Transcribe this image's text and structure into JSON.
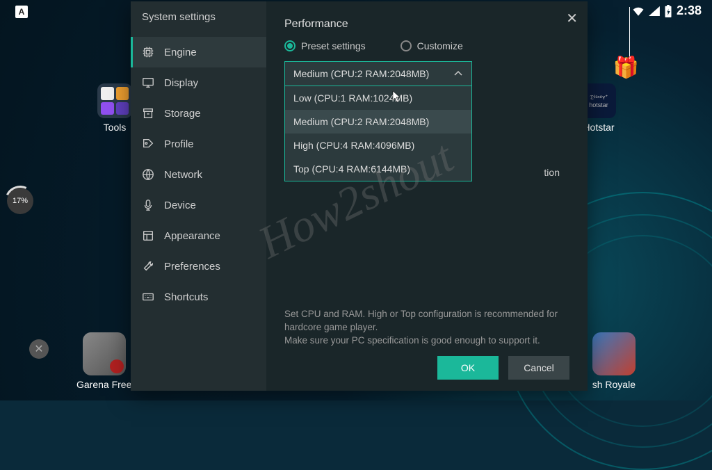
{
  "status_bar": {
    "time": "2:38"
  },
  "desktop": {
    "topleft_badge": "A",
    "tools_label": "Tools",
    "hotstar_label": "Hotstar",
    "hotstar_box_top": "𝔇ᴵˢⁿᵉʏ⁺",
    "hotstar_box_bottom": "hotstar",
    "pct": "17%",
    "game_left": "Garena Free",
    "game_right": "sh Royale"
  },
  "settings": {
    "title": "System settings",
    "sidebar": [
      {
        "label": "Engine",
        "icon": "cpu"
      },
      {
        "label": "Display",
        "icon": "monitor"
      },
      {
        "label": "Storage",
        "icon": "archive"
      },
      {
        "label": "Profile",
        "icon": "tag"
      },
      {
        "label": "Network",
        "icon": "globe"
      },
      {
        "label": "Device",
        "icon": "mic"
      },
      {
        "label": "Appearance",
        "icon": "layout"
      },
      {
        "label": "Preferences",
        "icon": "wrench"
      },
      {
        "label": "Shortcuts",
        "icon": "keyboard"
      }
    ],
    "active_index": 0,
    "panel": {
      "heading": "Performance",
      "radio_preset": "Preset settings",
      "radio_custom": "Customize",
      "dropdown_selected": "Medium (CPU:2 RAM:2048MB)",
      "dropdown_options": [
        "Low (CPU:1 RAM:1024MB)",
        "Medium (CPU:2 RAM:2048MB)",
        "High (CPU:4 RAM:4096MB)",
        "Top (CPU:4 RAM:6144MB)"
      ],
      "highlighted_index": 1,
      "hidden_text": "tion",
      "footer_line1": "Set CPU and RAM. High or Top configuration is recommended for hardcore game player.",
      "footer_line2": "Make sure your PC specification is good enough to support it.",
      "ok": "OK",
      "cancel": "Cancel"
    }
  },
  "watermark": "How2shout"
}
